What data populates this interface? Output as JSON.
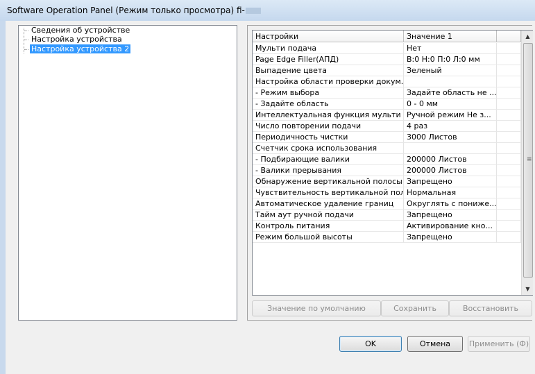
{
  "window": {
    "title": "Software Operation Panel (Режим только просмотра) fi-"
  },
  "tree": {
    "items": [
      {
        "label": "Сведения об устройстве",
        "selected": false
      },
      {
        "label": "Настройка устройства",
        "selected": false
      },
      {
        "label": "Настройка устройства 2",
        "selected": true
      }
    ]
  },
  "grid": {
    "columns": [
      "Настройки",
      "Значение 1",
      ""
    ],
    "rows": [
      [
        "Мульти подача",
        "Нет"
      ],
      [
        "Page Edge Filler(АПД)",
        "В:0 Н:0 П:0 Л:0 мм"
      ],
      [
        "Выпадение цвета",
        "Зеленый"
      ],
      [
        "Настройка области проверки докум...",
        ""
      ],
      [
        " - Режим выбора",
        "Задайте область не ..."
      ],
      [
        " - Задайте область",
        "0 - 0 мм"
      ],
      [
        "Интеллектуальная функция мульти п...",
        "Ручной режим  Не з..."
      ],
      [
        "Число повторении подачи",
        "4 раз"
      ],
      [
        "Периодичность чистки",
        "3000 Листов"
      ],
      [
        "Счетчик срока использования",
        ""
      ],
      [
        "- Подбирающие валики",
        "200000 Листов"
      ],
      [
        " - Валики прерывания",
        "200000 Листов"
      ],
      [
        "Обнаружение вертикальной полосы",
        "Запрещено"
      ],
      [
        "Чувствительность вертикальной пол...",
        "Нормальная"
      ],
      [
        "Автоматическое удаление границ",
        "Округлять с пониже..."
      ],
      [
        "Тайм аут ручной подачи",
        "Запрещено"
      ],
      [
        "Контроль питания",
        "Активирование кно..."
      ],
      [
        "Режим большой высоты",
        "Запрещено"
      ]
    ]
  },
  "panel_buttons": {
    "default_label": "Значение по умолчанию",
    "save_label": "Сохранить",
    "restore_label": "Восстановить"
  },
  "dialog_buttons": {
    "ok_label": "OK",
    "cancel_label": "Отмена",
    "apply_label": "Применить (Ф)"
  },
  "icons": {
    "scroll_up": "▲",
    "scroll_down": "▼",
    "scroll_grip": "≡"
  },
  "colors": {
    "selection": "#3399ff",
    "titlebar": "#c5d8ee"
  }
}
